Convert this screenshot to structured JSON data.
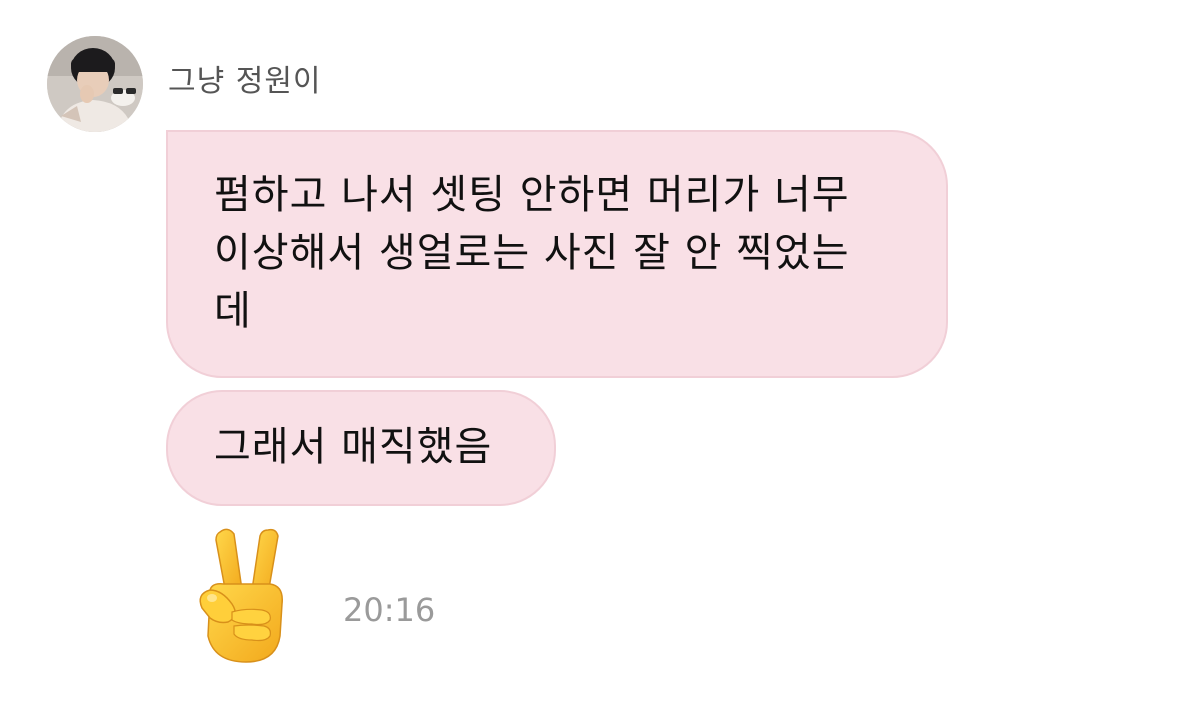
{
  "sender": {
    "name": "그냥 정원이"
  },
  "messages": [
    {
      "text": "펌하고 나서 셋팅 안하면 머리가 너무\n이상해서 생얼로는 사진 잘 안 찍었는\n데"
    },
    {
      "text": "그래서 매직했음"
    }
  ],
  "emoji_message": {
    "icon": "victory-hand-icon"
  },
  "timestamp": "20:16",
  "colors": {
    "bubble_bg": "#f9e0e6",
    "bubble_border": "#f1cfd7",
    "timestamp": "#9a9a9a",
    "sender_name": "#555555"
  }
}
